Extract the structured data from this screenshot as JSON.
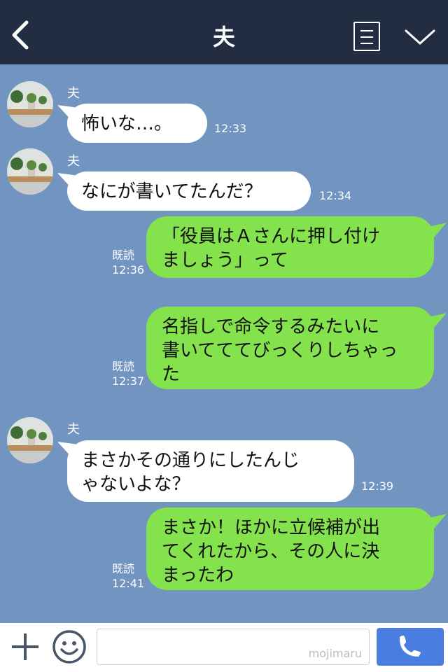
{
  "header": {
    "title": "夫",
    "back_icon": "chevron-left-icon",
    "menu_icon": "list-icon",
    "collapse_icon": "chevron-down-icon",
    "background": "#232d42"
  },
  "chat": {
    "background": "#7294c1",
    "bubble_in_color": "#ffffff",
    "bubble_out_color": "#84e24d",
    "messages": [
      {
        "direction": "in",
        "sender": "夫",
        "lines": [
          "怖いな…。"
        ],
        "time": "12:33"
      },
      {
        "direction": "in",
        "sender": "夫",
        "lines": [
          "なにが書いてたんだ？"
        ],
        "time": "12:34"
      },
      {
        "direction": "out",
        "read": "既読",
        "lines": [
          "「役員はＡさんに押し付け",
          "ましょう」って"
        ],
        "time": "12:36"
      },
      {
        "direction": "out",
        "read": "既読",
        "lines": [
          "名指しで命令するみたいに",
          "書いてててびっくりしちゃっ",
          "た"
        ],
        "time": "12:37"
      },
      {
        "direction": "in",
        "sender": "夫",
        "lines": [
          "まさかその通りにしたんじ",
          "ゃないよな？"
        ],
        "time": "12:39"
      },
      {
        "direction": "out",
        "read": "既読",
        "lines": [
          "まさか！ほかに立候補が出",
          "てくれたから、その人に決",
          "まったわ"
        ],
        "time": "12:41"
      }
    ]
  },
  "bottom_bar": {
    "plus_icon": "plus-icon",
    "emoji_icon": "smiley-icon",
    "input_value": "",
    "watermark": "mojimaru",
    "call_icon": "phone-icon",
    "call_button_color": "#4a7de0"
  }
}
